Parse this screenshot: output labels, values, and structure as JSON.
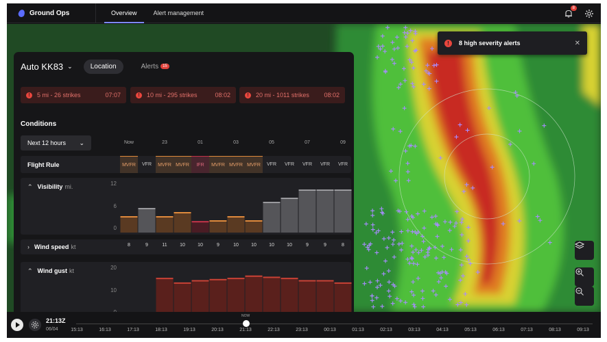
{
  "app": {
    "name": "Ground Ops",
    "tabs": [
      "Overview",
      "Alert management"
    ],
    "notif_count": "8"
  },
  "toast": {
    "text": "8 high severity alerts"
  },
  "panel": {
    "station": "Auto KK83",
    "tabs": {
      "location": "Location",
      "alerts": "Alerts",
      "alerts_count": "15"
    },
    "strikes": [
      {
        "label": "5 mi - 26 strikes",
        "time": "07:07"
      },
      {
        "label": "10 mi - 295 strikes",
        "time": "08:02"
      },
      {
        "label": "20 mi - 1011 strikes",
        "time": "08:02"
      }
    ],
    "conditions_title": "Conditions",
    "range_select": "Next 12 hours",
    "hour_labels": [
      "Now",
      "23",
      "01",
      "03",
      "05",
      "07",
      "09"
    ],
    "flight_rule": {
      "label": "Flight Rule",
      "values": [
        "MVFR",
        "VFR",
        "MVFR",
        "MVFR",
        "IFR",
        "MVFR",
        "MVFR",
        "MVFR",
        "VFR",
        "VFR",
        "VFR",
        "VFR",
        "VFR"
      ]
    },
    "visibility": {
      "label": "Visibility",
      "unit": "mi.",
      "yticks": [
        "12",
        "6",
        "0"
      ]
    },
    "wind_speed": {
      "label": "Wind speed",
      "unit": "kt",
      "values": [
        "8",
        "9",
        "11",
        "10",
        "10",
        "9",
        "10",
        "10",
        "10",
        "10",
        "9",
        "9",
        "8"
      ]
    },
    "wind_gust": {
      "label": "Wind gust",
      "unit": "kt",
      "yticks": [
        "20",
        "10",
        "0"
      ]
    }
  },
  "chart_data": [
    {
      "type": "bar",
      "title": "Visibility",
      "ylabel": "mi.",
      "ylim": [
        0,
        12
      ],
      "series": [
        {
          "values": [
            4,
            6,
            4,
            5,
            2.8,
            3,
            4,
            3,
            7.5,
            8.5,
            10.5,
            10.5,
            10.5
          ]
        }
      ]
    },
    {
      "type": "bar",
      "title": "Wind gust",
      "ylabel": "kt",
      "ylim": [
        0,
        22
      ],
      "series": [
        {
          "values": [
            0.5,
            0.5,
            17.5,
            15.5,
            16.5,
            17,
            17.5,
            18.5,
            18,
            17.5,
            16.5,
            16.5,
            15.5
          ]
        }
      ]
    }
  ],
  "colors": {
    "accent": "#7d8aff",
    "mvfr": "#e08a3c",
    "ifr": "#c4344a",
    "vfr": "#8a8a8a",
    "gust": "#c84236",
    "alert": "#e0413a"
  },
  "timeline": {
    "current_time": "21:13Z",
    "current_date": "06/04",
    "now_label": "NOW",
    "labels": [
      "15:13",
      "16:13",
      "17:13",
      "18:13",
      "19:13",
      "20:13",
      "21:13",
      "22:13",
      "23:13",
      "00:13",
      "01:13",
      "02:13",
      "03:13",
      "04:13",
      "05:13",
      "06:13",
      "07:13",
      "08:13",
      "09:13"
    ]
  }
}
